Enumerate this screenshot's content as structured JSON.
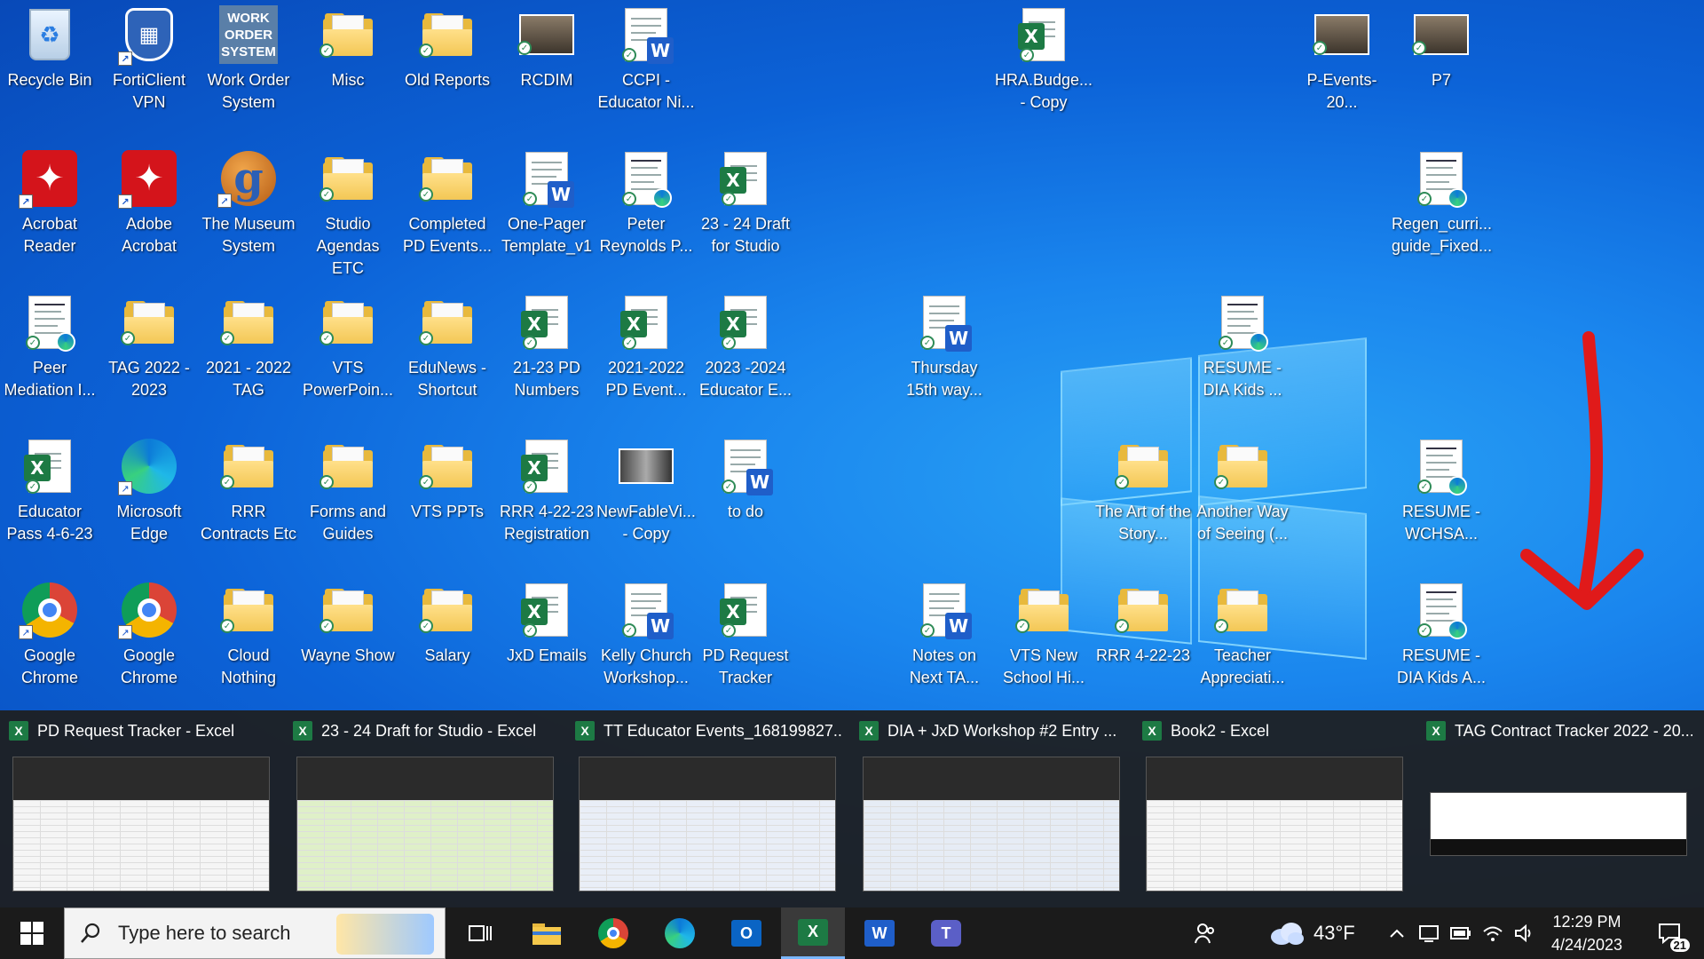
{
  "desktop_icons": [
    {
      "label": "Recycle Bin",
      "icon": "recycle-bin-icon"
    },
    {
      "label": "FortiClient VPN",
      "icon": "forticlient-icon"
    },
    {
      "label": "Work Order System",
      "icon": "work-order-icon",
      "logo_text": "WORK ORDER SYSTEM"
    },
    {
      "label": "Misc",
      "icon": "folder-icon"
    },
    {
      "label": "Old Reports",
      "icon": "folder-icon"
    },
    {
      "label": "RCDIM",
      "icon": "photo-icon"
    },
    {
      "label": "CCPI - Educator Ni...",
      "icon": "word-doc-icon"
    },
    {
      "label": "HRA.Budge... - Copy",
      "icon": "excel-file-icon"
    },
    {
      "label": "P-Events-20...",
      "icon": "photo-icon"
    },
    {
      "label": "P7",
      "icon": "photo-icon"
    },
    {
      "label": "Acrobat Reader",
      "icon": "acrobat-icon"
    },
    {
      "label": "Adobe Acrobat",
      "icon": "acrobat-icon"
    },
    {
      "label": "The Museum System",
      "icon": "museum-system-icon"
    },
    {
      "label": "Studio Agendas ETC",
      "icon": "folder-icon"
    },
    {
      "label": "Completed PD Events...",
      "icon": "folder-icon"
    },
    {
      "label": "One-Pager Template_v1",
      "icon": "word-doc-icon"
    },
    {
      "label": "Peter Reynolds P...",
      "icon": "pdf-edge-icon"
    },
    {
      "label": "23 - 24 Draft for Studio",
      "icon": "excel-file-icon"
    },
    {
      "label": "Regen_curri... guide_Fixed...",
      "icon": "pdf-edge-icon"
    },
    {
      "label": "Peer Mediation I...",
      "icon": "pdf-edge-icon"
    },
    {
      "label": "TAG 2022 - 2023",
      "icon": "folder-icon"
    },
    {
      "label": "2021 - 2022 TAG",
      "icon": "folder-icon"
    },
    {
      "label": "VTS PowerPoin...",
      "icon": "folder-icon"
    },
    {
      "label": "EduNews - Shortcut",
      "icon": "folder-icon"
    },
    {
      "label": "21-23 PD Numbers",
      "icon": "excel-file-icon"
    },
    {
      "label": "2021-2022 PD Event...",
      "icon": "excel-file-icon"
    },
    {
      "label": "2023 -2024 Educator E...",
      "icon": "excel-file-icon"
    },
    {
      "label": "Thursday 15th way...",
      "icon": "word-doc-icon"
    },
    {
      "label": "RESUME - DIA Kids ...",
      "icon": "pdf-edge-icon"
    },
    {
      "label": "Educator Pass 4-6-23",
      "icon": "excel-file-icon"
    },
    {
      "label": "Microsoft Edge",
      "icon": "edge-icon"
    },
    {
      "label": "RRR Contracts Etc",
      "icon": "folder-icon"
    },
    {
      "label": "Forms and Guides",
      "icon": "folder-icon"
    },
    {
      "label": "VTS PPTs",
      "icon": "folder-icon"
    },
    {
      "label": "RRR 4-22-23 Registration",
      "icon": "excel-file-icon"
    },
    {
      "label": "NewFableVi... - Copy",
      "icon": "video-icon"
    },
    {
      "label": "to do",
      "icon": "word-doc-icon"
    },
    {
      "label": "The Art of the Story...",
      "icon": "folder-icon"
    },
    {
      "label": "Another Way of Seeing (...",
      "icon": "folder-icon"
    },
    {
      "label": "RESUME - WCHSA...",
      "icon": "pdf-edge-icon"
    },
    {
      "label": "Google Chrome",
      "icon": "chrome-icon"
    },
    {
      "label": "Google Chrome",
      "icon": "chrome-icon"
    },
    {
      "label": "Cloud Nothing",
      "icon": "folder-icon"
    },
    {
      "label": "Wayne Show",
      "icon": "folder-icon"
    },
    {
      "label": "Salary",
      "icon": "folder-icon"
    },
    {
      "label": "JxD Emails",
      "icon": "excel-file-icon"
    },
    {
      "label": "Kelly Church Workshop...",
      "icon": "word-doc-icon"
    },
    {
      "label": "PD Request Tracker",
      "icon": "excel-file-icon"
    },
    {
      "label": "Notes on Next TA...",
      "icon": "word-doc-icon"
    },
    {
      "label": "VTS New School Hi...",
      "icon": "folder-icon"
    },
    {
      "label": "RRR 4-22-23",
      "icon": "folder-icon"
    },
    {
      "label": "Teacher Appreciati...",
      "icon": "folder-icon"
    },
    {
      "label": "RESUME - DIA Kids A...",
      "icon": "pdf-edge-icon"
    }
  ],
  "excel_previews": [
    {
      "title": "PD Request Tracker - Excel"
    },
    {
      "title": "23 - 24 Draft for Studio - Excel"
    },
    {
      "title": "TT Educator Events_168199827..."
    },
    {
      "title": "DIA + JxD Workshop #2 Entry ..."
    },
    {
      "title": "Book2 - Excel"
    },
    {
      "title": "TAG Contract Tracker 2022 - 20..."
    }
  ],
  "taskbar": {
    "search_placeholder": "Type here to search",
    "weather": "43°F",
    "time": "12:29 PM",
    "date": "4/24/2023",
    "notification_count": "21"
  },
  "colors": {
    "desktop_blue": "#1a86ee",
    "annotation_arrow": "#e01a1a",
    "excel_green": "#1d7a44",
    "word_blue": "#1f5ec9"
  }
}
